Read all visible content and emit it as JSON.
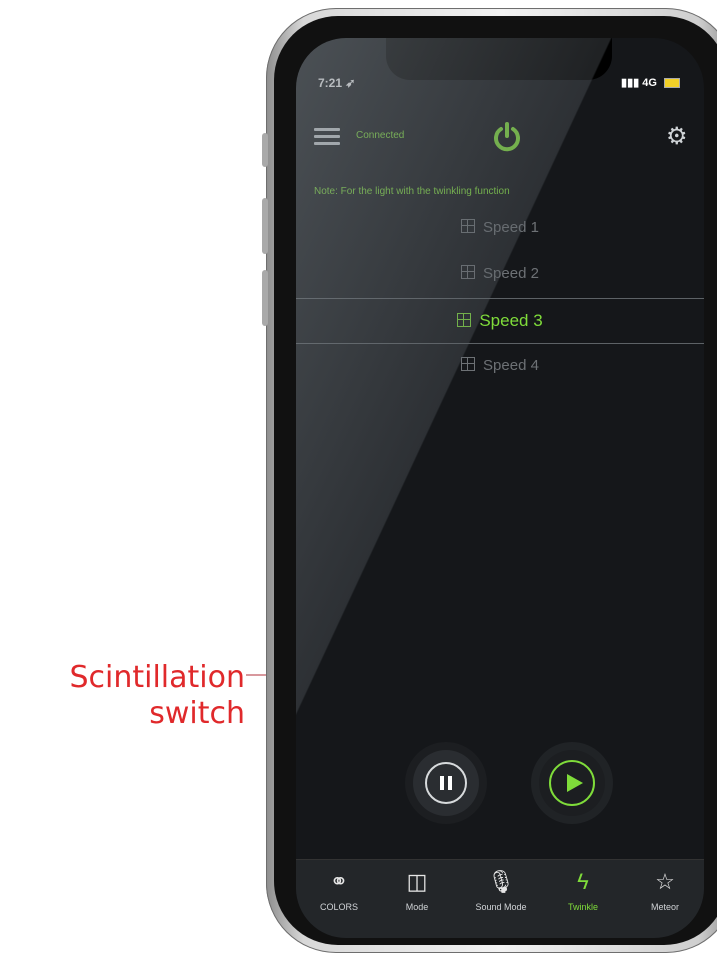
{
  "annotation": {
    "line1": "Scintillation",
    "line2": "switch"
  },
  "status": {
    "time": "7:21",
    "network": "4G"
  },
  "header": {
    "status_text": "Connected"
  },
  "note": "Note: For the light with the twinkling function",
  "speeds": [
    {
      "label": "Speed 1",
      "selected": false
    },
    {
      "label": "Speed 2",
      "selected": false
    },
    {
      "label": "Speed 3",
      "selected": true
    },
    {
      "label": "Speed 4",
      "selected": false
    }
  ],
  "controls": {
    "pause": "pause-icon",
    "play": "play-icon"
  },
  "tabs": [
    {
      "label": "COLORS",
      "icon": "colors-icon",
      "active": false
    },
    {
      "label": "Mode",
      "icon": "mode-icon",
      "active": false
    },
    {
      "label": "Sound Mode",
      "icon": "microphone-icon",
      "active": false
    },
    {
      "label": "Twinkle",
      "icon": "lightning-icon",
      "active": true
    },
    {
      "label": "Meteor",
      "icon": "star-icon",
      "active": false
    }
  ],
  "colors": {
    "accent": "#7fdc3a",
    "annotation": "#e0292b",
    "background": "#15171a"
  }
}
